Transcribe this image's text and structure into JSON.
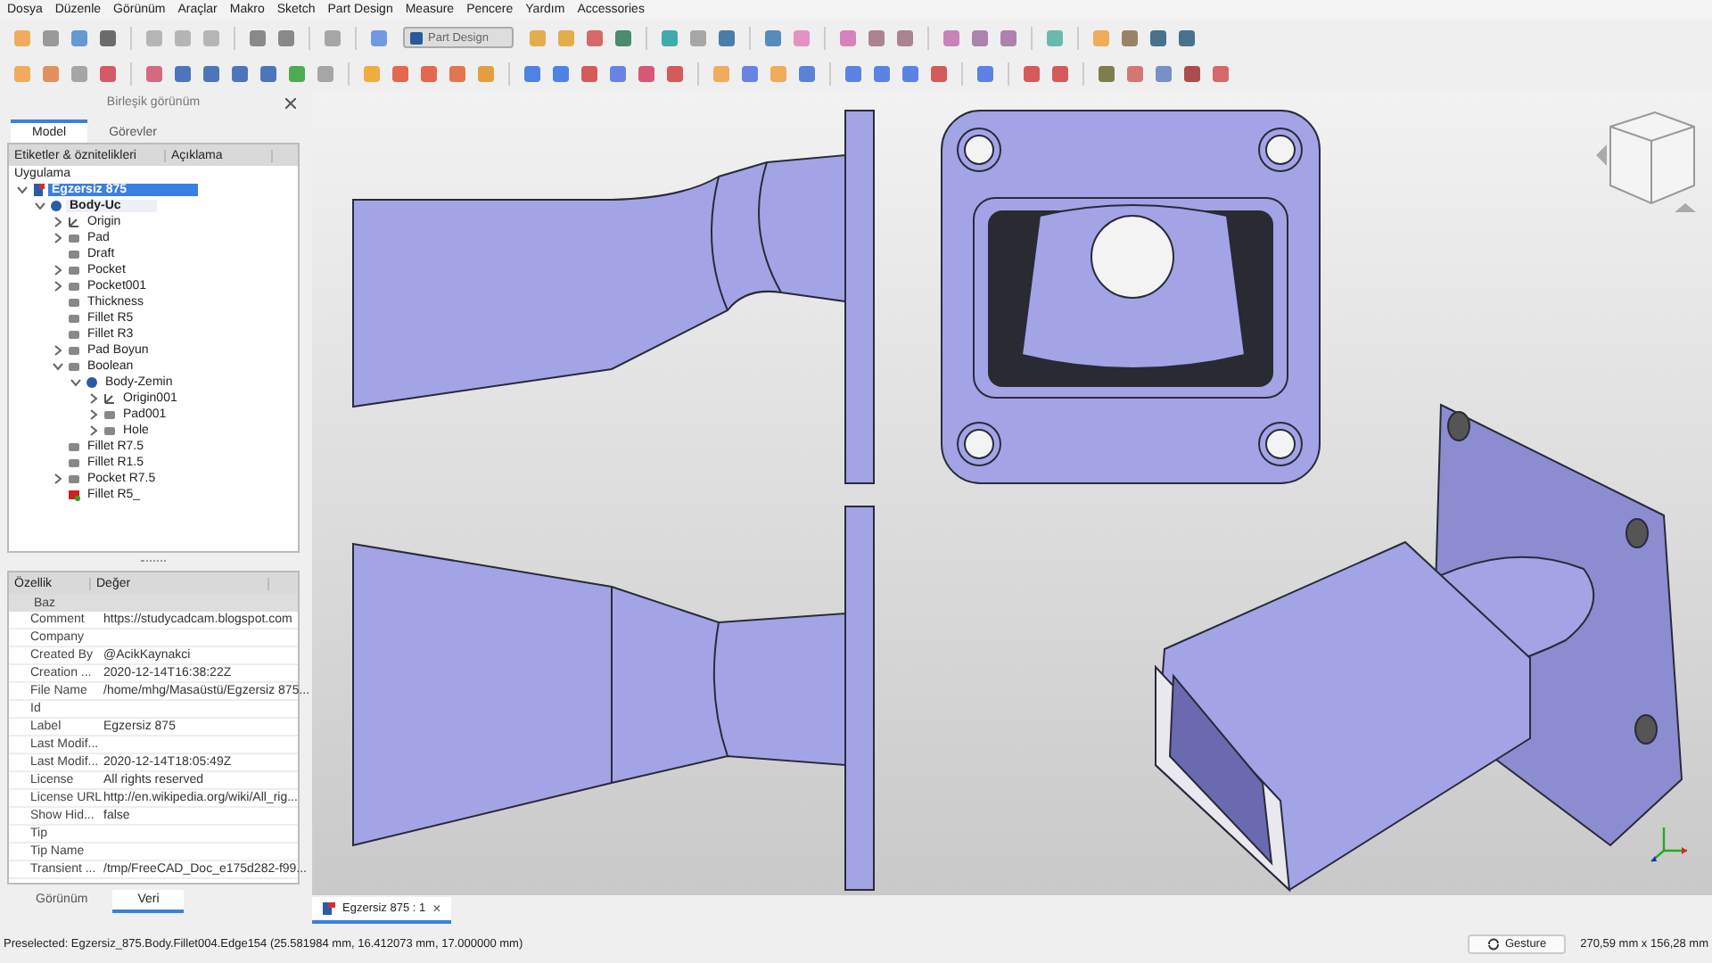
{
  "menu": [
    "Dosya",
    "Düzenle",
    "Görünüm",
    "Araçlar",
    "Makro",
    "Sketch",
    "Part Design",
    "Measure",
    "Pencere",
    "Yardım",
    "Accessories"
  ],
  "workbench": {
    "value": "Part Design"
  },
  "panel": {
    "title": "Birleşik görünüm",
    "tabs": [
      {
        "label": "Model",
        "selected": true
      },
      {
        "label": "Görevler",
        "selected": false
      }
    ]
  },
  "tree": {
    "columns": [
      "Etiketler & öznitelikleri",
      "Açıklama"
    ],
    "root_label": "Uygulama",
    "items": [
      {
        "label": "Egzersiz 875",
        "kind": "document",
        "expanded": true,
        "selected": true,
        "children": [
          {
            "label": "Body-Uc",
            "kind": "body",
            "expanded": true,
            "selected": false,
            "active": true,
            "children": [
              {
                "label": "Origin",
                "kind": "origin",
                "expanded": false,
                "selected": false
              },
              {
                "label": "Pad",
                "kind": "feature",
                "expanded": false,
                "selected": false
              },
              {
                "label": "Draft",
                "kind": "feature",
                "selected": false
              },
              {
                "label": "Pocket",
                "kind": "feature",
                "expanded": false,
                "selected": false
              },
              {
                "label": "Pocket001",
                "kind": "feature",
                "expanded": false,
                "selected": false
              },
              {
                "label": "Thickness",
                "kind": "feature",
                "selected": false
              },
              {
                "label": "Fillet R5",
                "kind": "feature",
                "selected": false
              },
              {
                "label": "Fillet R3",
                "kind": "feature",
                "selected": false
              },
              {
                "label": "Pad Boyun",
                "kind": "feature",
                "expanded": false,
                "selected": false
              },
              {
                "label": "Boolean",
                "kind": "feature",
                "expanded": true,
                "selected": false,
                "children": [
                  {
                    "label": "Body-Zemin",
                    "kind": "body",
                    "expanded": true,
                    "selected": false,
                    "active": false,
                    "children": [
                      {
                        "label": "Origin001",
                        "kind": "origin",
                        "expanded": false,
                        "selected": false
                      },
                      {
                        "label": "Pad001",
                        "kind": "feature",
                        "expanded": false,
                        "selected": false
                      },
                      {
                        "label": "Hole",
                        "kind": "feature",
                        "expanded": false,
                        "selected": false
                      }
                    ]
                  }
                ]
              },
              {
                "label": "Fillet R7.5",
                "kind": "feature",
                "selected": false
              },
              {
                "label": "Fillet R1.5",
                "kind": "feature",
                "selected": false
              },
              {
                "label": "Pocket R7.5",
                "kind": "feature",
                "expanded": false,
                "selected": false
              },
              {
                "label": "Fillet R5_",
                "kind": "error",
                "selected": false
              }
            ]
          }
        ]
      }
    ]
  },
  "properties": {
    "columns": [
      "Özellik",
      "Değer"
    ],
    "group": "Baz",
    "rows": [
      {
        "name": "Comment",
        "value": "https://studycadcam.blogspot.com"
      },
      {
        "name": "Company",
        "value": ""
      },
      {
        "name": "Created By",
        "value": "@AcikKaynakci"
      },
      {
        "name": "Creation ...",
        "value": "2020-12-14T16:38:22Z"
      },
      {
        "name": "File Name",
        "value": "/home/mhg/Masaüstü/Egzersiz 875..."
      },
      {
        "name": "Id",
        "value": ""
      },
      {
        "name": "Label",
        "value": "Egzersiz 875"
      },
      {
        "name": "Last Modif...",
        "value": ""
      },
      {
        "name": "Last Modif...",
        "value": "2020-12-14T18:05:49Z"
      },
      {
        "name": "License",
        "value": "All rights reserved"
      },
      {
        "name": "License URL",
        "value": "http://en.wikipedia.org/wiki/All_rig..."
      },
      {
        "name": "Show Hid...",
        "value": "false"
      },
      {
        "name": "Tip",
        "value": ""
      },
      {
        "name": "Tip Name",
        "value": ""
      },
      {
        "name": "Transient ...",
        "value": "/tmp/FreeCAD_Doc_e175d282-f99..."
      }
    ]
  },
  "bottom_tabs": [
    {
      "label": "Görünüm",
      "selected": false
    },
    {
      "label": "Veri",
      "selected": true
    }
  ],
  "document_tab": {
    "label": "Egzersiz 875 : 1",
    "close": "×"
  },
  "status_bar": {
    "message": "Preselected: Egzersiz_875.Body.Fillet004.Edge154 (25.581984 mm, 16.412073 mm, 17.000000 mm)",
    "navigation": "Gesture",
    "dimensions": "270,59 mm x 156,28 mm"
  }
}
